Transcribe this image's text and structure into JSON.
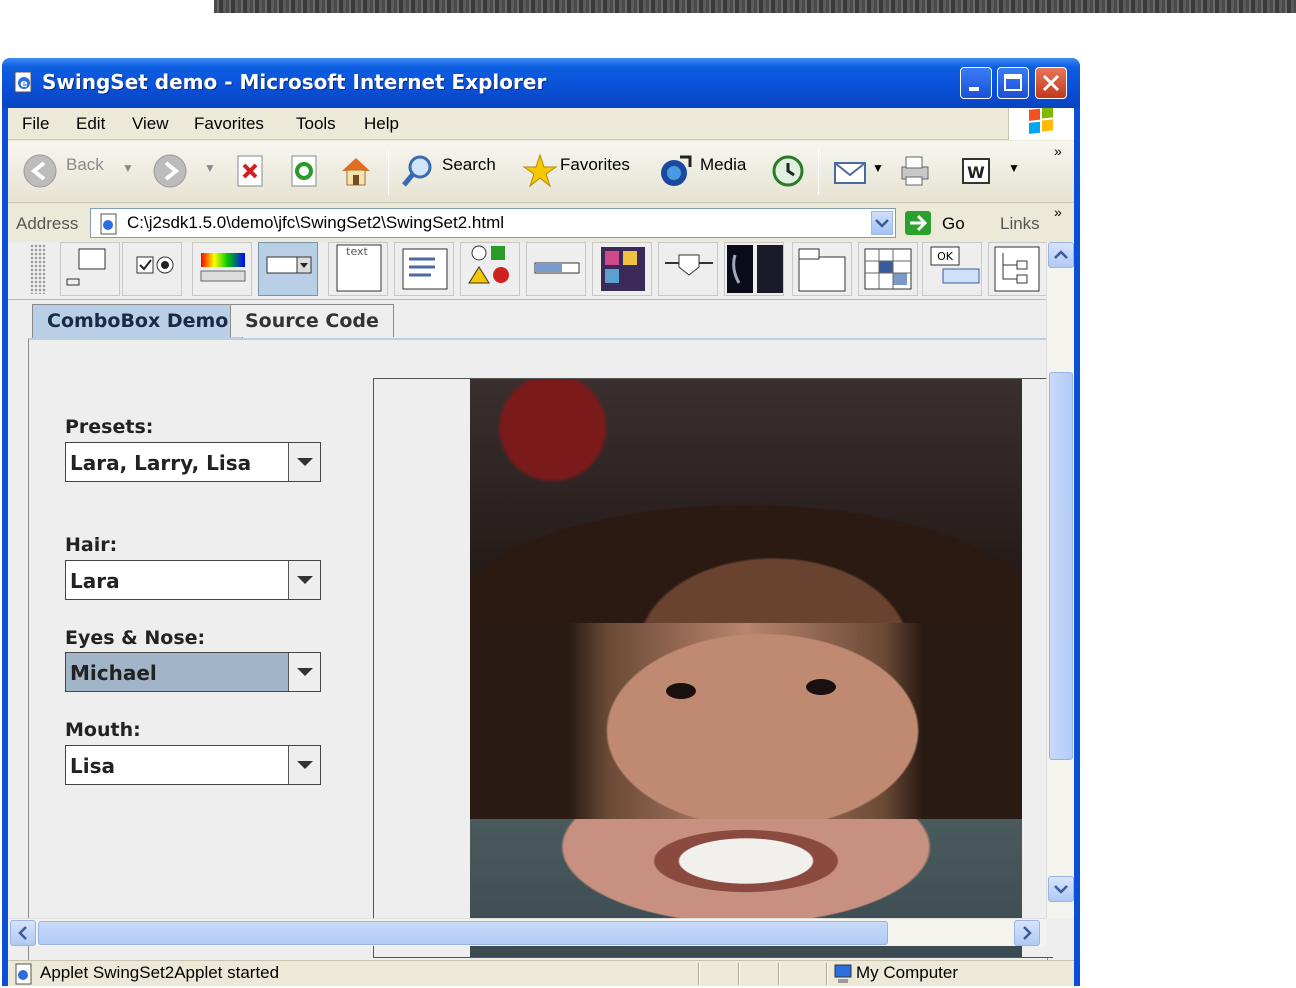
{
  "window": {
    "title": "SwingSet demo - Microsoft Internet Explorer"
  },
  "menu": [
    "File",
    "Edit",
    "View",
    "Favorites",
    "Tools",
    "Help"
  ],
  "toolbar": {
    "back": "Back",
    "search": "Search",
    "favorites": "Favorites",
    "media": "Media"
  },
  "address": {
    "label": "Address",
    "url": "C:\\j2sdk1.5.0\\demo\\jfc\\SwingSet2\\SwingSet2.html",
    "go": "Go",
    "links": "Links"
  },
  "applet": {
    "tabs": [
      "ComboBox Demo",
      "Source Code"
    ],
    "combos": [
      {
        "label": "Presets:",
        "value": "Lara, Larry, Lisa"
      },
      {
        "label": "Hair:",
        "value": "Lara"
      },
      {
        "label": "Eyes & Nose:",
        "value": "Michael"
      },
      {
        "label": "Mouth:",
        "value": "Lisa"
      }
    ]
  },
  "status": {
    "text": "Applet SwingSet2Applet started",
    "zone": "My Computer"
  },
  "colors": {
    "titlebar": "#0a50d8",
    "selected": "#b8cfe5",
    "combo_selected": "#a2b4c8"
  }
}
